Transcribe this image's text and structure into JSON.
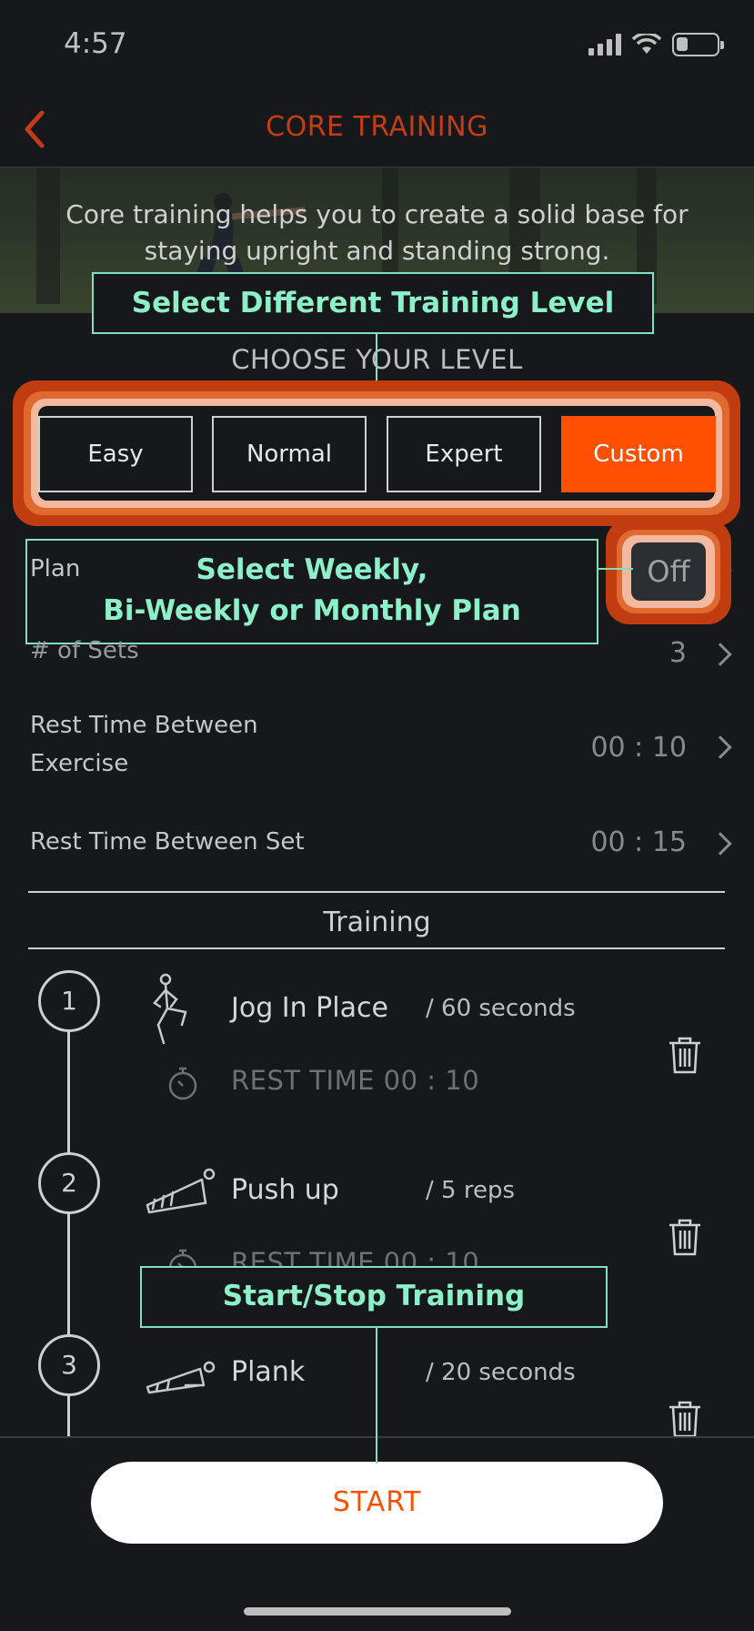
{
  "status_bar": {
    "time": "4:57"
  },
  "nav": {
    "title": "CORE TRAINING"
  },
  "hero": {
    "description": "Core training helps you to create a solid base for staying upright and standing strong."
  },
  "level": {
    "heading": "CHOOSE YOUR LEVEL",
    "options": [
      {
        "label": "Easy",
        "selected": false
      },
      {
        "label": "Normal",
        "selected": false
      },
      {
        "label": "Expert",
        "selected": false
      },
      {
        "label": "Custom",
        "selected": true
      }
    ]
  },
  "settings": {
    "plan": {
      "label": "Plan",
      "value": "Off"
    },
    "sets": {
      "label": "# of Sets",
      "value": "3"
    },
    "rest_exercise": {
      "label_line1": "Rest Time Between",
      "label_line2": "Exercise",
      "value": "00 : 10"
    },
    "rest_set": {
      "label": "Rest Time Between Set",
      "value": "00 : 15"
    }
  },
  "training": {
    "header": "Training",
    "exercises": [
      {
        "number": "1",
        "name": "Jog In Place",
        "amount": "/ 60 seconds",
        "rest": "REST TIME 00 : 10",
        "icon": "jogging-figure-icon"
      },
      {
        "number": "2",
        "name": "Push up",
        "amount": "/ 5 reps",
        "rest": "REST TIME 00 : 10",
        "icon": "pushup-figure-icon"
      },
      {
        "number": "3",
        "name": "Plank",
        "amount": "/ 20 seconds",
        "rest": "",
        "icon": "plank-figure-icon"
      }
    ]
  },
  "annotations": {
    "level": "Select Different Training Level",
    "plan_line1": "Select Weekly,",
    "plan_line2": "Bi-Weekly or Monthly Plan",
    "start": "Start/Stop Training"
  },
  "start_button": {
    "label": "START"
  },
  "colors": {
    "accent": "#ff5000",
    "nav_accent": "#c53d14",
    "annotation": "#7ee0bd",
    "background": "#16181b"
  }
}
